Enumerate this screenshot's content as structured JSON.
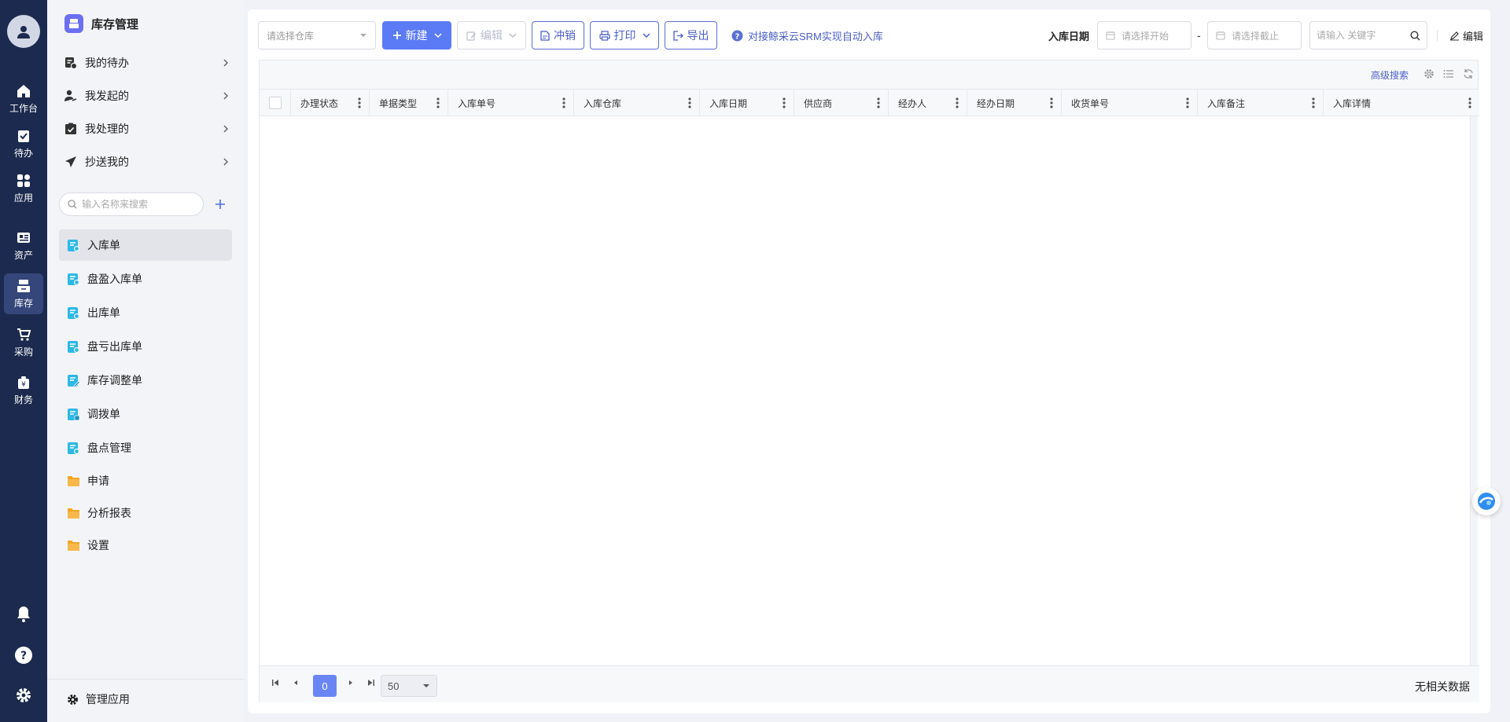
{
  "rail": {
    "items": [
      {
        "label": "工作台",
        "icon": "home-icon"
      },
      {
        "label": "待办",
        "icon": "todo-check-icon"
      },
      {
        "label": "应用",
        "icon": "apps-grid-icon"
      },
      {
        "label": "资产",
        "icon": "asset-card-icon"
      },
      {
        "label": "库存",
        "icon": "inventory-icon"
      },
      {
        "label": "采购",
        "icon": "cart-icon"
      },
      {
        "label": "财务",
        "icon": "finance-icon"
      }
    ],
    "active": "库存",
    "bottom_icons": [
      "bell-icon",
      "help-icon",
      "settings-gear-icon"
    ]
  },
  "sidebar": {
    "title": "库存管理",
    "tasks": [
      {
        "label": "我的待办"
      },
      {
        "label": "我发起的"
      },
      {
        "label": "我处理的"
      },
      {
        "label": "抄送我的"
      }
    ],
    "search_placeholder": "输入名称来搜索",
    "forms": [
      {
        "label": "入库单"
      },
      {
        "label": "盘盈入库单"
      },
      {
        "label": "出库单"
      },
      {
        "label": "盘亏出库单"
      },
      {
        "label": "库存调整单"
      },
      {
        "label": "调拨单"
      },
      {
        "label": "盘点管理"
      }
    ],
    "folders": [
      {
        "label": "申请"
      },
      {
        "label": "分析报表"
      },
      {
        "label": "设置"
      }
    ],
    "active_item": "入库单",
    "manage_label": "管理应用"
  },
  "toolbar": {
    "warehouse_placeholder": "请选择仓库",
    "new_label": "新建",
    "edit_label": "编辑",
    "reverse_label": "冲销",
    "print_label": "打印",
    "export_label": "导出",
    "srm_link": "对接鲸采云SRM实现自动入库",
    "date_label": "入库日期",
    "date_start_placeholder": "请选择开始",
    "date_end_placeholder": "请选择截止",
    "date_sep": "-",
    "keyword_placeholder": "请输入 关键字",
    "edit_link": "编辑"
  },
  "table": {
    "advanced_search": "高级搜索",
    "columns": [
      "办理状态",
      "单据类型",
      "入库单号",
      "入库仓库",
      "入库日期",
      "供应商",
      "经办人",
      "经办日期",
      "收货单号",
      "入库备注",
      "入库详情"
    ],
    "rows": []
  },
  "pager": {
    "current_page": "0",
    "page_size": "50",
    "empty_text": "无相关数据"
  },
  "colors": {
    "rail_bg": "#1b2a4e",
    "accent": "#5b7af5",
    "link": "#4b5fc8"
  }
}
